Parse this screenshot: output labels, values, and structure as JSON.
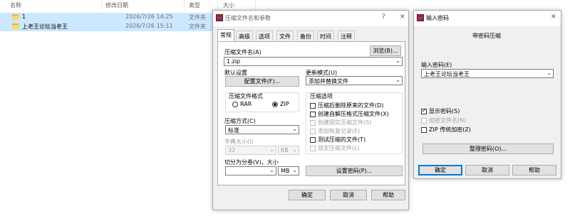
{
  "explorer": {
    "columns": {
      "name": "名称",
      "modified": "修改日期",
      "type": "类型",
      "size": "大小"
    },
    "rows": [
      {
        "name": "1",
        "modified": "2026/7/26 14:25",
        "type": "文件夹"
      },
      {
        "name": "上老王论坛当老王",
        "modified": "2026/7/26 15:11",
        "type": "文件夹"
      }
    ]
  },
  "archive_dialog": {
    "title": "压缩文件名和参数",
    "help_glyph": "?",
    "close_glyph": "✕",
    "tabs": [
      "常规",
      "高级",
      "选项",
      "文件",
      "备份",
      "时间",
      "注释"
    ],
    "active_tab": "常规",
    "archive_name_label": "压缩文件名(A)",
    "browse_button": "浏览(B)...",
    "archive_name_value": "1.zip",
    "default_settings_label": "默认设置",
    "profiles_button": "配置文件(F)...",
    "update_mode_label": "更新模式(U)",
    "update_mode_value": "添加并替换文件",
    "format_label": "压缩文件格式",
    "format_rar": "RAR",
    "format_zip": "ZIP",
    "selected_format": "ZIP",
    "options_label": "压缩选项",
    "options": [
      {
        "label": "压缩后删除原来的文件(D)",
        "checked": false,
        "disabled": false
      },
      {
        "label": "创建自解压格式压缩文件(X)",
        "checked": false,
        "disabled": false
      },
      {
        "label": "创建固实压缩文件(S)",
        "checked": false,
        "disabled": true
      },
      {
        "label": "添加恢复记录(E)",
        "checked": false,
        "disabled": true
      },
      {
        "label": "测试压缩的文件(T)",
        "checked": false,
        "disabled": false
      },
      {
        "label": "锁定压缩文件(L)",
        "checked": false,
        "disabled": true
      }
    ],
    "method_label": "压缩方式(C)",
    "method_value": "标准",
    "dict_label": "字典大小(I)",
    "dict_value": "32",
    "dict_unit": "KB",
    "split_label": "切分为分卷(V)，大小",
    "split_value": "",
    "split_unit": "MB",
    "set_password_button": "设置密码(P)...",
    "ok_button": "确定",
    "cancel_button": "取消",
    "help_button": "帮助"
  },
  "password_dialog": {
    "title": "输入密码",
    "close_glyph": "✕",
    "heading": "带密码压缩",
    "password_label": "输入密码(E)",
    "password_value": "上老王论坛当老王",
    "show_password": {
      "label": "显示密码(S)",
      "checked": true,
      "disabled": false
    },
    "encrypt_names": {
      "label": "加密文件名(N)",
      "checked": false,
      "disabled": true
    },
    "zip_legacy": {
      "label": "ZIP 传统加密(Z)",
      "checked": false,
      "disabled": false
    },
    "organize_button": "整理密码(O)...",
    "ok_button": "确定",
    "cancel_button": "取消",
    "help_button": "帮助"
  }
}
